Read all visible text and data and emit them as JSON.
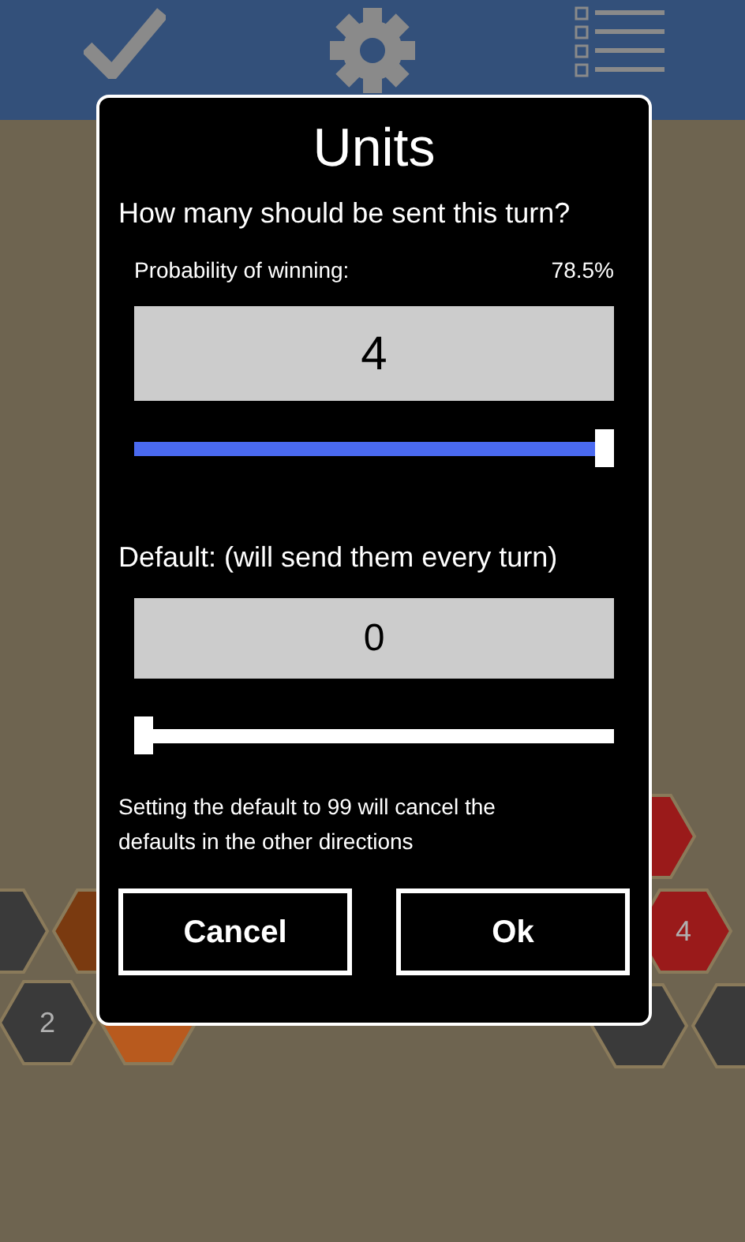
{
  "toolbar": {
    "items": [
      {
        "kind": "check"
      },
      {
        "kind": "gear"
      },
      {
        "kind": "list"
      }
    ]
  },
  "board": {
    "tiles": [
      {
        "color": "#3a3a3a"
      },
      {
        "color": "#7a3a10"
      },
      {
        "color": "#3a3a3a",
        "label": "2"
      },
      {
        "color": "#b85a1e"
      },
      {
        "color": "#9a1a1a"
      },
      {
        "color": "#9a1a1a",
        "label": "4"
      },
      {
        "color": "#3a3a3a"
      },
      {
        "color": "#3a3a3a"
      }
    ]
  },
  "dialog": {
    "title": "Units",
    "question": "How many should be sent this turn?",
    "probability_label": "Probability of winning:",
    "probability_value": "78.5%",
    "send": {
      "value": "4",
      "level": 1.0
    },
    "default_label": "Default: (will send them every turn)",
    "default": {
      "value": "0",
      "level": 0.0
    },
    "note": "Setting the default to 99 will cancel the defaults in the other directions",
    "buttons": [
      "Cancel",
      "Ok"
    ]
  }
}
